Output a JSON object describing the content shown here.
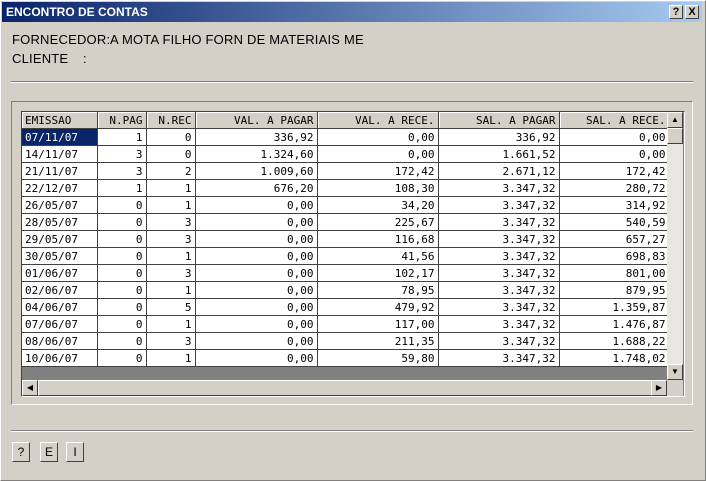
{
  "window": {
    "title": "ENCONTRO DE CONTAS",
    "help_btn": "?",
    "close_btn": "X"
  },
  "header": {
    "fornecedor_label": "FORNECEDOR:",
    "fornecedor_value": "A MOTA FILHO FORN DE MATERIAIS ME",
    "cliente_label": "CLIENTE",
    "cliente_sep": ":"
  },
  "table": {
    "columns": [
      "EMISSAO",
      "N.PAG",
      "N.REC",
      "VAL. A PAGAR",
      "VAL. A RECE.",
      "SAL. A PAGAR",
      "SAL. A RECE."
    ],
    "rows": [
      [
        "07/11/07",
        "1",
        "0",
        "336,92",
        "0,00",
        "336,92",
        "0,00"
      ],
      [
        "14/11/07",
        "3",
        "0",
        "1.324,60",
        "0,00",
        "1.661,52",
        "0,00"
      ],
      [
        "21/11/07",
        "3",
        "2",
        "1.009,60",
        "172,42",
        "2.671,12",
        "172,42"
      ],
      [
        "22/12/07",
        "1",
        "1",
        "676,20",
        "108,30",
        "3.347,32",
        "280,72"
      ],
      [
        "26/05/07",
        "0",
        "1",
        "0,00",
        "34,20",
        "3.347,32",
        "314,92"
      ],
      [
        "28/05/07",
        "0",
        "3",
        "0,00",
        "225,67",
        "3.347,32",
        "540,59"
      ],
      [
        "29/05/07",
        "0",
        "3",
        "0,00",
        "116,68",
        "3.347,32",
        "657,27"
      ],
      [
        "30/05/07",
        "0",
        "1",
        "0,00",
        "41,56",
        "3.347,32",
        "698,83"
      ],
      [
        "01/06/07",
        "0",
        "3",
        "0,00",
        "102,17",
        "3.347,32",
        "801,00"
      ],
      [
        "02/06/07",
        "0",
        "1",
        "0,00",
        "78,95",
        "3.347,32",
        "879,95"
      ],
      [
        "04/06/07",
        "0",
        "5",
        "0,00",
        "479,92",
        "3.347,32",
        "1.359,87"
      ],
      [
        "07/06/07",
        "0",
        "1",
        "0,00",
        "117,00",
        "3.347,32",
        "1.476,87"
      ],
      [
        "08/06/07",
        "0",
        "3",
        "0,00",
        "211,35",
        "3.347,32",
        "1.688,22"
      ],
      [
        "10/06/07",
        "0",
        "1",
        "0,00",
        "59,80",
        "3.347,32",
        "1.748,02"
      ]
    ]
  },
  "footer": {
    "buttons": [
      "?",
      "E",
      "I"
    ]
  },
  "icons": {
    "up": "scroll-up-arrow-icon",
    "down": "scroll-down-arrow-icon",
    "left": "scroll-left-arrow-icon",
    "right": "scroll-right-arrow-icon"
  },
  "colors": {
    "title_start": "#0a246a",
    "title_end": "#a6caf0",
    "selection": "#0a246a",
    "face": "#d4d0c8"
  }
}
